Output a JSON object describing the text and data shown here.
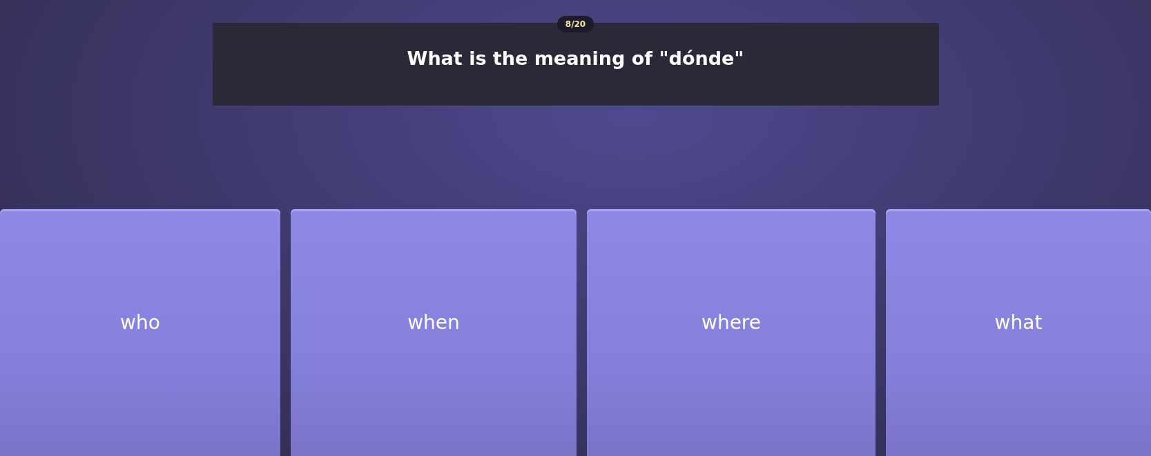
{
  "progress": "8/20",
  "question": "What is the meaning of \"dónde\"",
  "answers": [
    {
      "label": "who"
    },
    {
      "label": "when"
    },
    {
      "label": "where"
    },
    {
      "label": "what"
    }
  ]
}
